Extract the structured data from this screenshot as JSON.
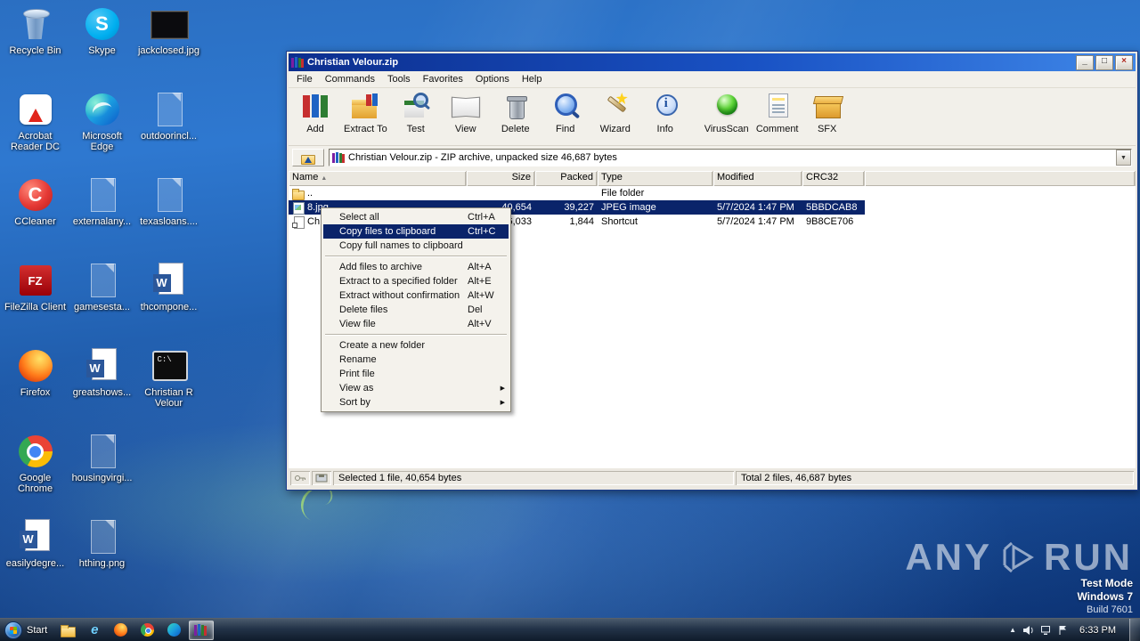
{
  "icon_glyphs": {
    "skype": "S",
    "ccleaner": "C",
    "filezilla": "FZ",
    "word": "W",
    "terminal": "C:\\",
    "tb-info": "i",
    "ti-ie": "e"
  },
  "desktop": {
    "columns": [
      {
        "items": [
          {
            "label": "Recycle Bin",
            "kind": "recycle-bin"
          },
          {
            "label": "Acrobat Reader DC",
            "kind": "acrobat"
          },
          {
            "label": "CCleaner",
            "kind": "ccleaner"
          },
          {
            "label": "FileZilla Client",
            "kind": "filezilla"
          },
          {
            "label": "Firefox",
            "kind": "firefox"
          },
          {
            "label": "Google Chrome",
            "kind": "chrome"
          },
          {
            "label": "easilydegre...",
            "kind": "word"
          }
        ]
      },
      {
        "items": [
          {
            "label": "Skype",
            "kind": "skype"
          },
          {
            "label": "Microsoft Edge",
            "kind": "edge"
          },
          {
            "label": "externalany...",
            "kind": "ghost"
          },
          {
            "label": "gamesesta...",
            "kind": "ghost"
          },
          {
            "label": "greatshows...",
            "kind": "word"
          },
          {
            "label": "housingvirgi...",
            "kind": "ghost"
          },
          {
            "label": "hthing.png",
            "kind": "ghost"
          }
        ]
      },
      {
        "items": [
          {
            "label": "jackclosed.jpg",
            "kind": "image-black"
          },
          {
            "label": "outdoorincl...",
            "kind": "ghost"
          },
          {
            "label": "texasloans....",
            "kind": "ghost"
          },
          {
            "label": "thcompone...",
            "kind": "word"
          },
          {
            "label": "Christian R Velour",
            "kind": "terminal"
          }
        ]
      }
    ]
  },
  "winrar": {
    "title": "Christian Velour.zip",
    "window_buttons": [
      {
        "kind": "minimize",
        "glyph": "_"
      },
      {
        "kind": "maximize",
        "glyph": "□"
      },
      {
        "kind": "close",
        "glyph": "×"
      }
    ],
    "menu": [
      "File",
      "Commands",
      "Tools",
      "Favorites",
      "Options",
      "Help"
    ],
    "toolbar": [
      {
        "label": "Add",
        "kind": "add"
      },
      {
        "label": "Extract To",
        "kind": "extract"
      },
      {
        "label": "Test",
        "kind": "test"
      },
      {
        "label": "View",
        "kind": "view"
      },
      {
        "label": "Delete",
        "kind": "delete"
      },
      {
        "label": "Find",
        "kind": "find"
      },
      {
        "label": "Wizard",
        "kind": "wizard"
      },
      {
        "label": "Info",
        "kind": "info"
      },
      {
        "label": "VirusScan",
        "kind": "virusscan"
      },
      {
        "label": "Comment",
        "kind": "comment"
      },
      {
        "label": "SFX",
        "kind": "sfx"
      }
    ],
    "address": "Christian Velour.zip - ZIP archive, unpacked size 46,687 bytes",
    "columns": [
      "Name",
      "Size",
      "Packed",
      "Type",
      "Modified",
      "CRC32"
    ],
    "sort_column": "Name",
    "rows": [
      {
        "icon": "folder-up",
        "name": "..",
        "size": "",
        "packed": "",
        "type": "File folder",
        "modified": "",
        "crc": "",
        "selected": false
      },
      {
        "icon": "jpeg",
        "name": "8.jpg",
        "size": "40,654",
        "packed": "39,227",
        "type": "JPEG image",
        "modified": "5/7/2024 1:47 PM",
        "crc": "5BBDCAB8",
        "selected": true
      },
      {
        "icon": "shortcut",
        "name": "Ch",
        "size": "6,033",
        "packed": "1,844",
        "type": "Shortcut",
        "modified": "5/7/2024 1:47 PM",
        "crc": "9B8CE706",
        "selected": false
      }
    ],
    "status_left": "Selected 1 file, 40,654 bytes",
    "status_right": "Total 2 files, 46,687 bytes"
  },
  "context_menu": {
    "items": [
      {
        "label": "Select all",
        "shortcut": "Ctrl+A"
      },
      {
        "label": "Copy files to clipboard",
        "shortcut": "Ctrl+C",
        "highlighted": true
      },
      {
        "label": "Copy full names to clipboard",
        "shortcut": ""
      },
      {
        "separator": true
      },
      {
        "label": "Add files to archive",
        "shortcut": "Alt+A"
      },
      {
        "label": "Extract to a specified folder",
        "shortcut": "Alt+E"
      },
      {
        "label": "Extract without confirmation",
        "shortcut": "Alt+W"
      },
      {
        "label": "Delete files",
        "shortcut": "Del"
      },
      {
        "label": "View file",
        "shortcut": "Alt+V"
      },
      {
        "separator": true
      },
      {
        "label": "Create a new folder",
        "shortcut": ""
      },
      {
        "label": "Rename",
        "shortcut": ""
      },
      {
        "label": "Print file",
        "shortcut": ""
      },
      {
        "label": "View as",
        "shortcut": "",
        "submenu": true
      },
      {
        "label": "Sort by",
        "shortcut": "",
        "submenu": true
      }
    ]
  },
  "taskbar": {
    "start_label": "Start",
    "apps": [
      {
        "kind": "explorer"
      },
      {
        "kind": "ie"
      },
      {
        "kind": "firefox"
      },
      {
        "kind": "chrome"
      },
      {
        "kind": "edge"
      },
      {
        "kind": "winrar",
        "active": true
      }
    ],
    "clock": "6:33 PM"
  },
  "watermark": {
    "brand_left": "ANY",
    "brand_right": "RUN",
    "mode": "Test Mode",
    "os": "Windows 7",
    "build": "Build 7601"
  },
  "colors": {
    "selection": "#0a246a",
    "titlebar_start": "#0c2e8e",
    "titlebar_end": "#3f87e8"
  }
}
